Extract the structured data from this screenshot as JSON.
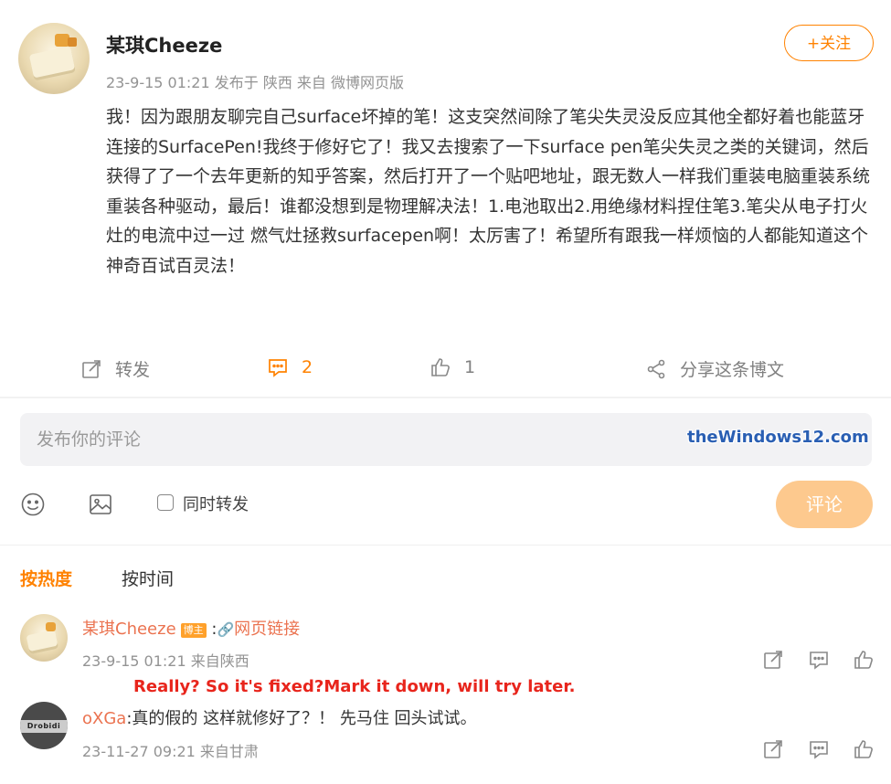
{
  "post": {
    "author": "某琪Cheeze",
    "meta": "23-9-15 01:21 发布于 陕西 来自 微博网页版",
    "follow_label": "+关注",
    "body": "我！因为跟朋友聊完自己surface坏掉的笔！这支突然间除了笔尖失灵没反应其他全都好着也能蓝牙连接的SurfacePen!我终于修好它了！我又去搜索了一下surface pen笔尖失灵之类的关键词，然后获得了了一个去年更新的知乎答案，然后打开了一个贴吧地址，跟无数人一样我们重装电脑重装系统重装各种驱动，最后！谁都没想到是物理解决法！1.电池取出2.用绝缘材料捏住笔3.笔尖从电子打火灶的电流中过一过 燃气灶拯救surfacepen啊！太厉害了！希望所有跟我一样烦恼的人都能知道这个神奇百试百灵法！",
    "actions": {
      "repost": "转发",
      "comments": "2",
      "likes": "1",
      "share": "分享这条博文"
    }
  },
  "compose": {
    "placeholder": "发布你的评论",
    "also_repost": "同时转发",
    "submit": "评论"
  },
  "watermark": "theWindows12.com",
  "sort": {
    "hot": "按热度",
    "time": "按时间"
  },
  "comments": [
    {
      "name": "某琪Cheeze",
      "badge": "博主",
      "text_prefix": " :",
      "link_text": "网页链接",
      "meta": "23-9-15 01:21 来自陕西"
    },
    {
      "name": "oXGa",
      "text": ":真的假的 这样就修好了？！ 先马住 回头试试。",
      "meta": "23-11-27 09:21 来自甘肃",
      "avatar_text": "Drobidi"
    }
  ],
  "overlay_note": "Really? So it's fixed?Mark it down, will try later.",
  "colors": {
    "accent": "#ff8200",
    "name": "#eb7350",
    "submit_bg": "#fdc98e",
    "overlay_red": "#e8251c",
    "watermark_blue": "#2a5fb3"
  }
}
